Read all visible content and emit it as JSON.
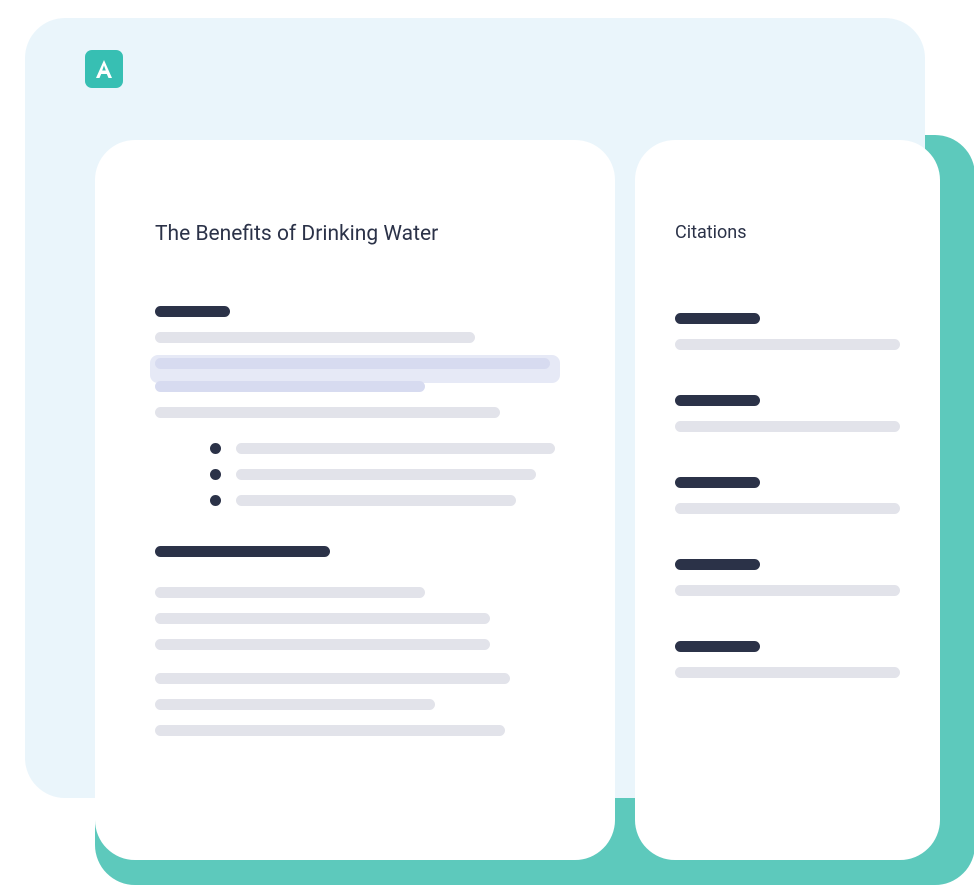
{
  "document": {
    "title": "The Benefits of Drinking Water"
  },
  "sidebar": {
    "title": "Citations"
  },
  "colors": {
    "teal": "#5dc9bc",
    "lightBg": "#eaf5fb",
    "dark": "#2b3248",
    "grey": "#e2e3ea",
    "highlight": "#d7dbf0"
  }
}
